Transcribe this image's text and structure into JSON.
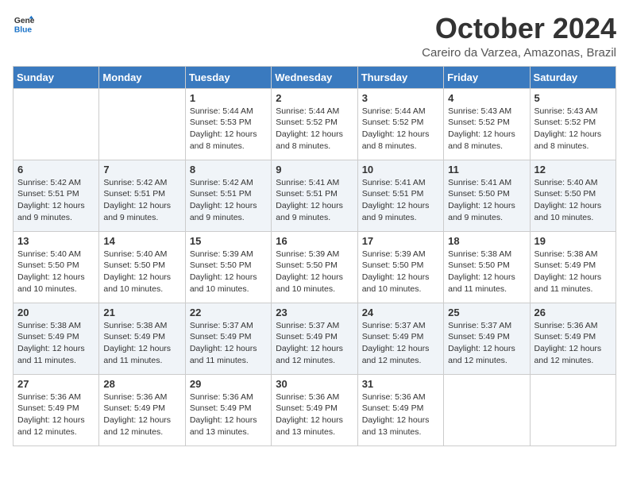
{
  "header": {
    "logo_line1": "General",
    "logo_line2": "Blue",
    "month": "October 2024",
    "location": "Careiro da Varzea, Amazonas, Brazil"
  },
  "weekdays": [
    "Sunday",
    "Monday",
    "Tuesday",
    "Wednesday",
    "Thursday",
    "Friday",
    "Saturday"
  ],
  "weeks": [
    [
      {
        "day": "",
        "info": ""
      },
      {
        "day": "",
        "info": ""
      },
      {
        "day": "1",
        "info": "Sunrise: 5:44 AM\nSunset: 5:53 PM\nDaylight: 12 hours and 8 minutes."
      },
      {
        "day": "2",
        "info": "Sunrise: 5:44 AM\nSunset: 5:52 PM\nDaylight: 12 hours and 8 minutes."
      },
      {
        "day": "3",
        "info": "Sunrise: 5:44 AM\nSunset: 5:52 PM\nDaylight: 12 hours and 8 minutes."
      },
      {
        "day": "4",
        "info": "Sunrise: 5:43 AM\nSunset: 5:52 PM\nDaylight: 12 hours and 8 minutes."
      },
      {
        "day": "5",
        "info": "Sunrise: 5:43 AM\nSunset: 5:52 PM\nDaylight: 12 hours and 8 minutes."
      }
    ],
    [
      {
        "day": "6",
        "info": "Sunrise: 5:42 AM\nSunset: 5:51 PM\nDaylight: 12 hours and 9 minutes."
      },
      {
        "day": "7",
        "info": "Sunrise: 5:42 AM\nSunset: 5:51 PM\nDaylight: 12 hours and 9 minutes."
      },
      {
        "day": "8",
        "info": "Sunrise: 5:42 AM\nSunset: 5:51 PM\nDaylight: 12 hours and 9 minutes."
      },
      {
        "day": "9",
        "info": "Sunrise: 5:41 AM\nSunset: 5:51 PM\nDaylight: 12 hours and 9 minutes."
      },
      {
        "day": "10",
        "info": "Sunrise: 5:41 AM\nSunset: 5:51 PM\nDaylight: 12 hours and 9 minutes."
      },
      {
        "day": "11",
        "info": "Sunrise: 5:41 AM\nSunset: 5:50 PM\nDaylight: 12 hours and 9 minutes."
      },
      {
        "day": "12",
        "info": "Sunrise: 5:40 AM\nSunset: 5:50 PM\nDaylight: 12 hours and 10 minutes."
      }
    ],
    [
      {
        "day": "13",
        "info": "Sunrise: 5:40 AM\nSunset: 5:50 PM\nDaylight: 12 hours and 10 minutes."
      },
      {
        "day": "14",
        "info": "Sunrise: 5:40 AM\nSunset: 5:50 PM\nDaylight: 12 hours and 10 minutes."
      },
      {
        "day": "15",
        "info": "Sunrise: 5:39 AM\nSunset: 5:50 PM\nDaylight: 12 hours and 10 minutes."
      },
      {
        "day": "16",
        "info": "Sunrise: 5:39 AM\nSunset: 5:50 PM\nDaylight: 12 hours and 10 minutes."
      },
      {
        "day": "17",
        "info": "Sunrise: 5:39 AM\nSunset: 5:50 PM\nDaylight: 12 hours and 10 minutes."
      },
      {
        "day": "18",
        "info": "Sunrise: 5:38 AM\nSunset: 5:50 PM\nDaylight: 12 hours and 11 minutes."
      },
      {
        "day": "19",
        "info": "Sunrise: 5:38 AM\nSunset: 5:49 PM\nDaylight: 12 hours and 11 minutes."
      }
    ],
    [
      {
        "day": "20",
        "info": "Sunrise: 5:38 AM\nSunset: 5:49 PM\nDaylight: 12 hours and 11 minutes."
      },
      {
        "day": "21",
        "info": "Sunrise: 5:38 AM\nSunset: 5:49 PM\nDaylight: 12 hours and 11 minutes."
      },
      {
        "day": "22",
        "info": "Sunrise: 5:37 AM\nSunset: 5:49 PM\nDaylight: 12 hours and 11 minutes."
      },
      {
        "day": "23",
        "info": "Sunrise: 5:37 AM\nSunset: 5:49 PM\nDaylight: 12 hours and 12 minutes."
      },
      {
        "day": "24",
        "info": "Sunrise: 5:37 AM\nSunset: 5:49 PM\nDaylight: 12 hours and 12 minutes."
      },
      {
        "day": "25",
        "info": "Sunrise: 5:37 AM\nSunset: 5:49 PM\nDaylight: 12 hours and 12 minutes."
      },
      {
        "day": "26",
        "info": "Sunrise: 5:36 AM\nSunset: 5:49 PM\nDaylight: 12 hours and 12 minutes."
      }
    ],
    [
      {
        "day": "27",
        "info": "Sunrise: 5:36 AM\nSunset: 5:49 PM\nDaylight: 12 hours and 12 minutes."
      },
      {
        "day": "28",
        "info": "Sunrise: 5:36 AM\nSunset: 5:49 PM\nDaylight: 12 hours and 12 minutes."
      },
      {
        "day": "29",
        "info": "Sunrise: 5:36 AM\nSunset: 5:49 PM\nDaylight: 12 hours and 13 minutes."
      },
      {
        "day": "30",
        "info": "Sunrise: 5:36 AM\nSunset: 5:49 PM\nDaylight: 12 hours and 13 minutes."
      },
      {
        "day": "31",
        "info": "Sunrise: 5:36 AM\nSunset: 5:49 PM\nDaylight: 12 hours and 13 minutes."
      },
      {
        "day": "",
        "info": ""
      },
      {
        "day": "",
        "info": ""
      }
    ]
  ]
}
